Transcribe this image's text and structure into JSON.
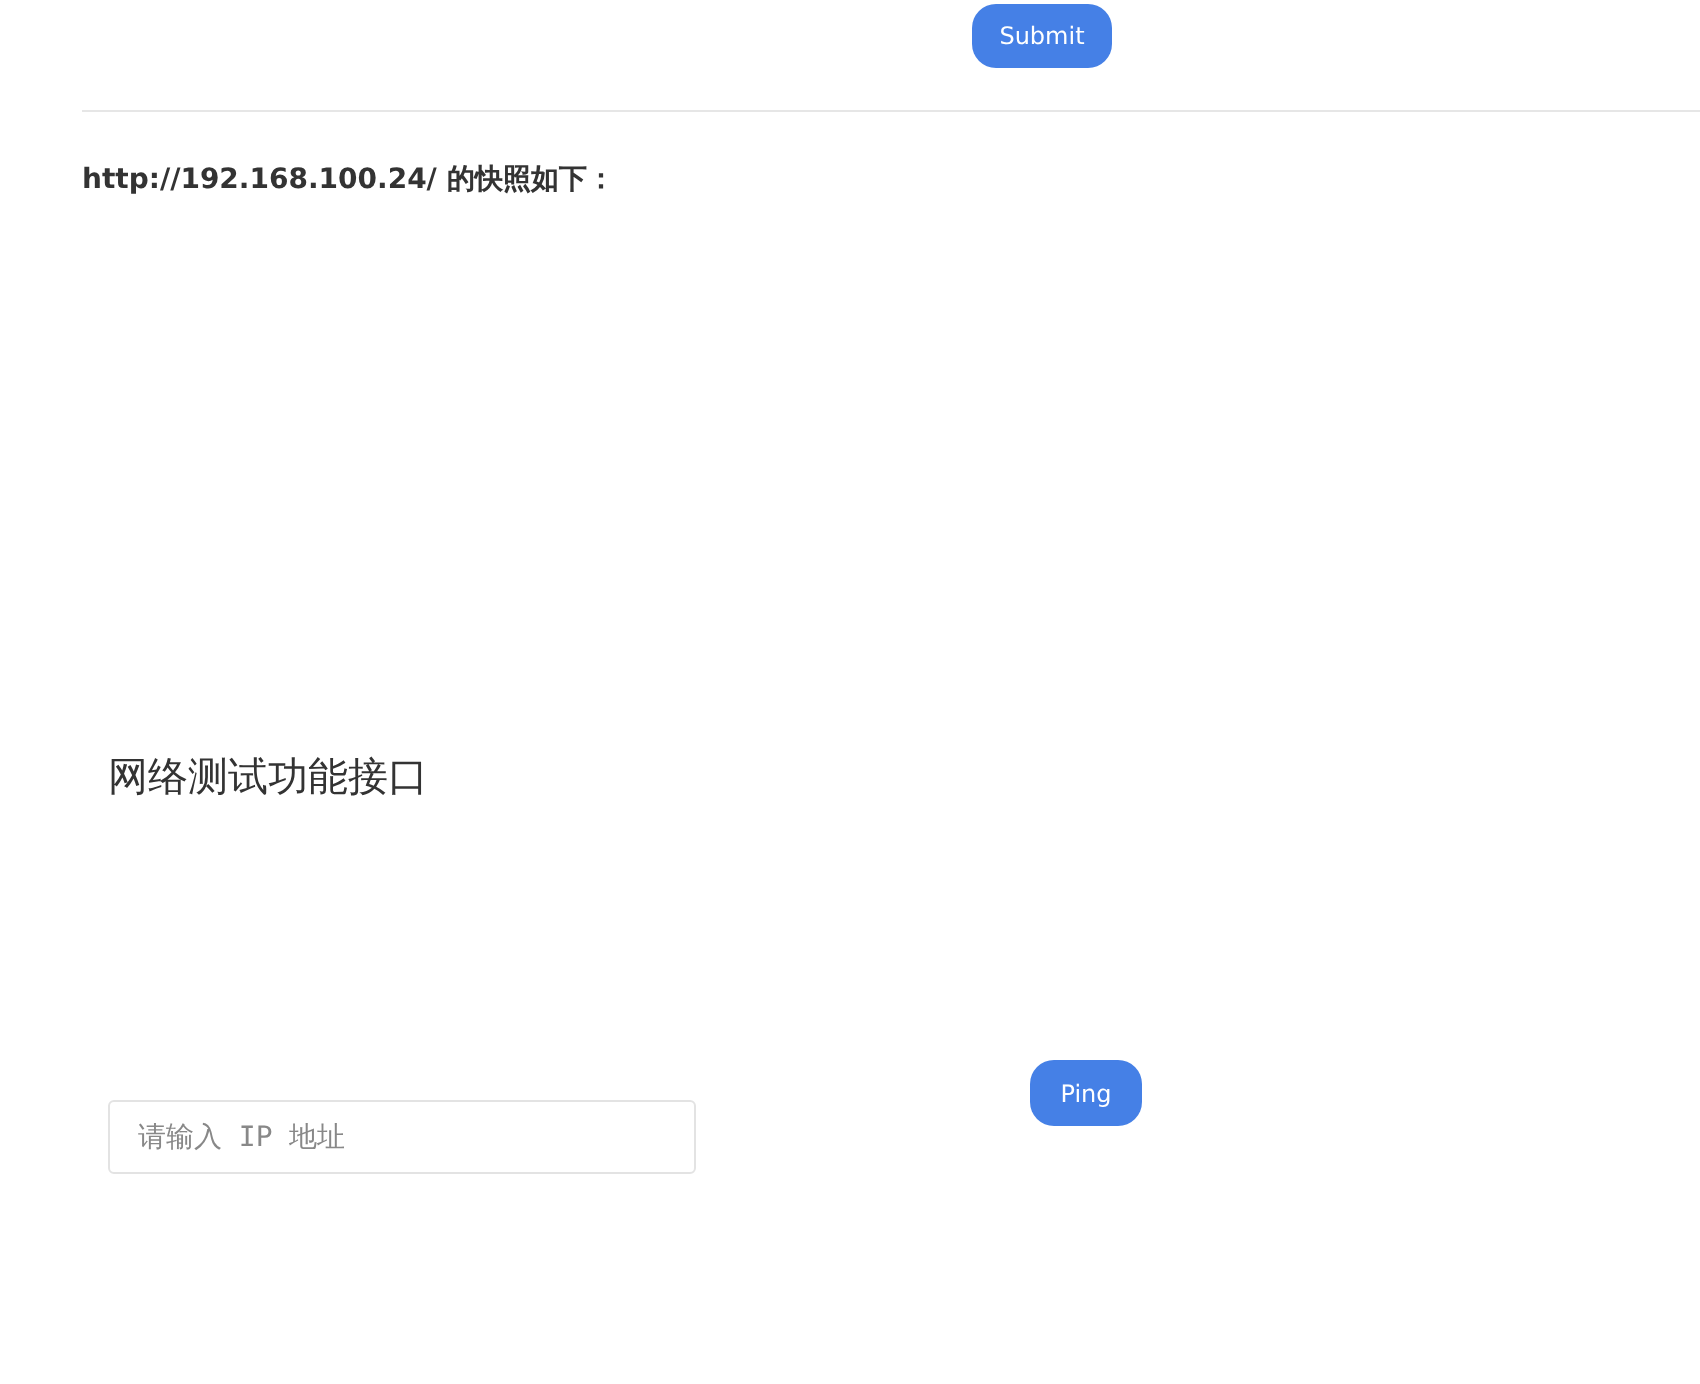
{
  "submit_button": "Submit",
  "snapshot_caption": "http://192.168.100.24/ 的快照如下：",
  "snapshot_frame": {
    "heading": "网络测试功能接口",
    "ip_field": {
      "placeholder": "请输入 IP 地址"
    },
    "ping_button": "Ping"
  }
}
